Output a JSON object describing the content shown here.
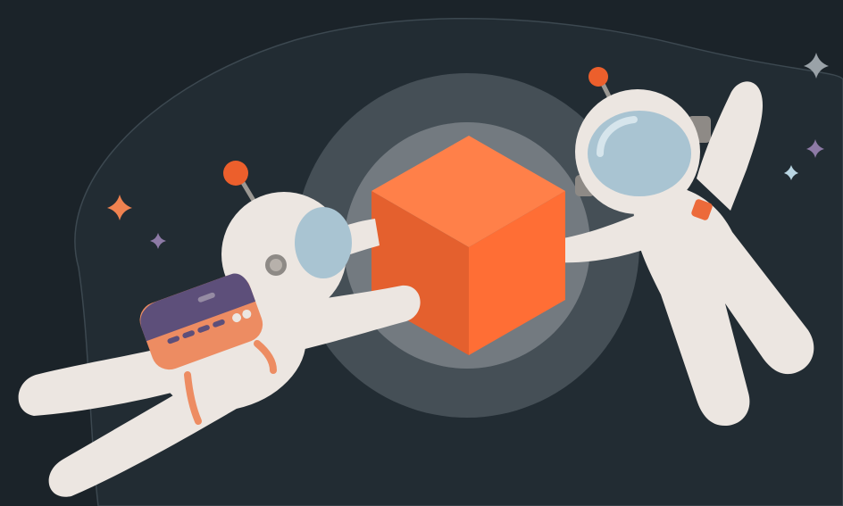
{
  "scene": {
    "description_visible_text": [],
    "colors": {
      "background": "#1b2329",
      "blob": "#222c33",
      "blob_outline": "#3c4850",
      "halo_outer": "#454f56",
      "halo_inner": "#737a80",
      "cube_top": "#ff8049",
      "cube_left": "#e4602e",
      "cube_right": "#ff6e35",
      "suit": "#ece6e1",
      "suit_shadow": "#d9d1cb",
      "visor": "#a9c4d2",
      "visor_shine": "#d6e5ec",
      "antenna_ball": "#ec5f2c",
      "backpack": "#ed8c62",
      "backpack_flap": "#5d4f7a",
      "star_orange": "#ef8250",
      "star_purple": "#8d7aa6",
      "star_grey": "#9aa2a8",
      "star_blue": "#b9d5e2"
    },
    "icons": [
      "astronaut-left-illustration",
      "astronaut-right-illustration",
      "cube-illustration",
      "sparkle-icon"
    ]
  }
}
